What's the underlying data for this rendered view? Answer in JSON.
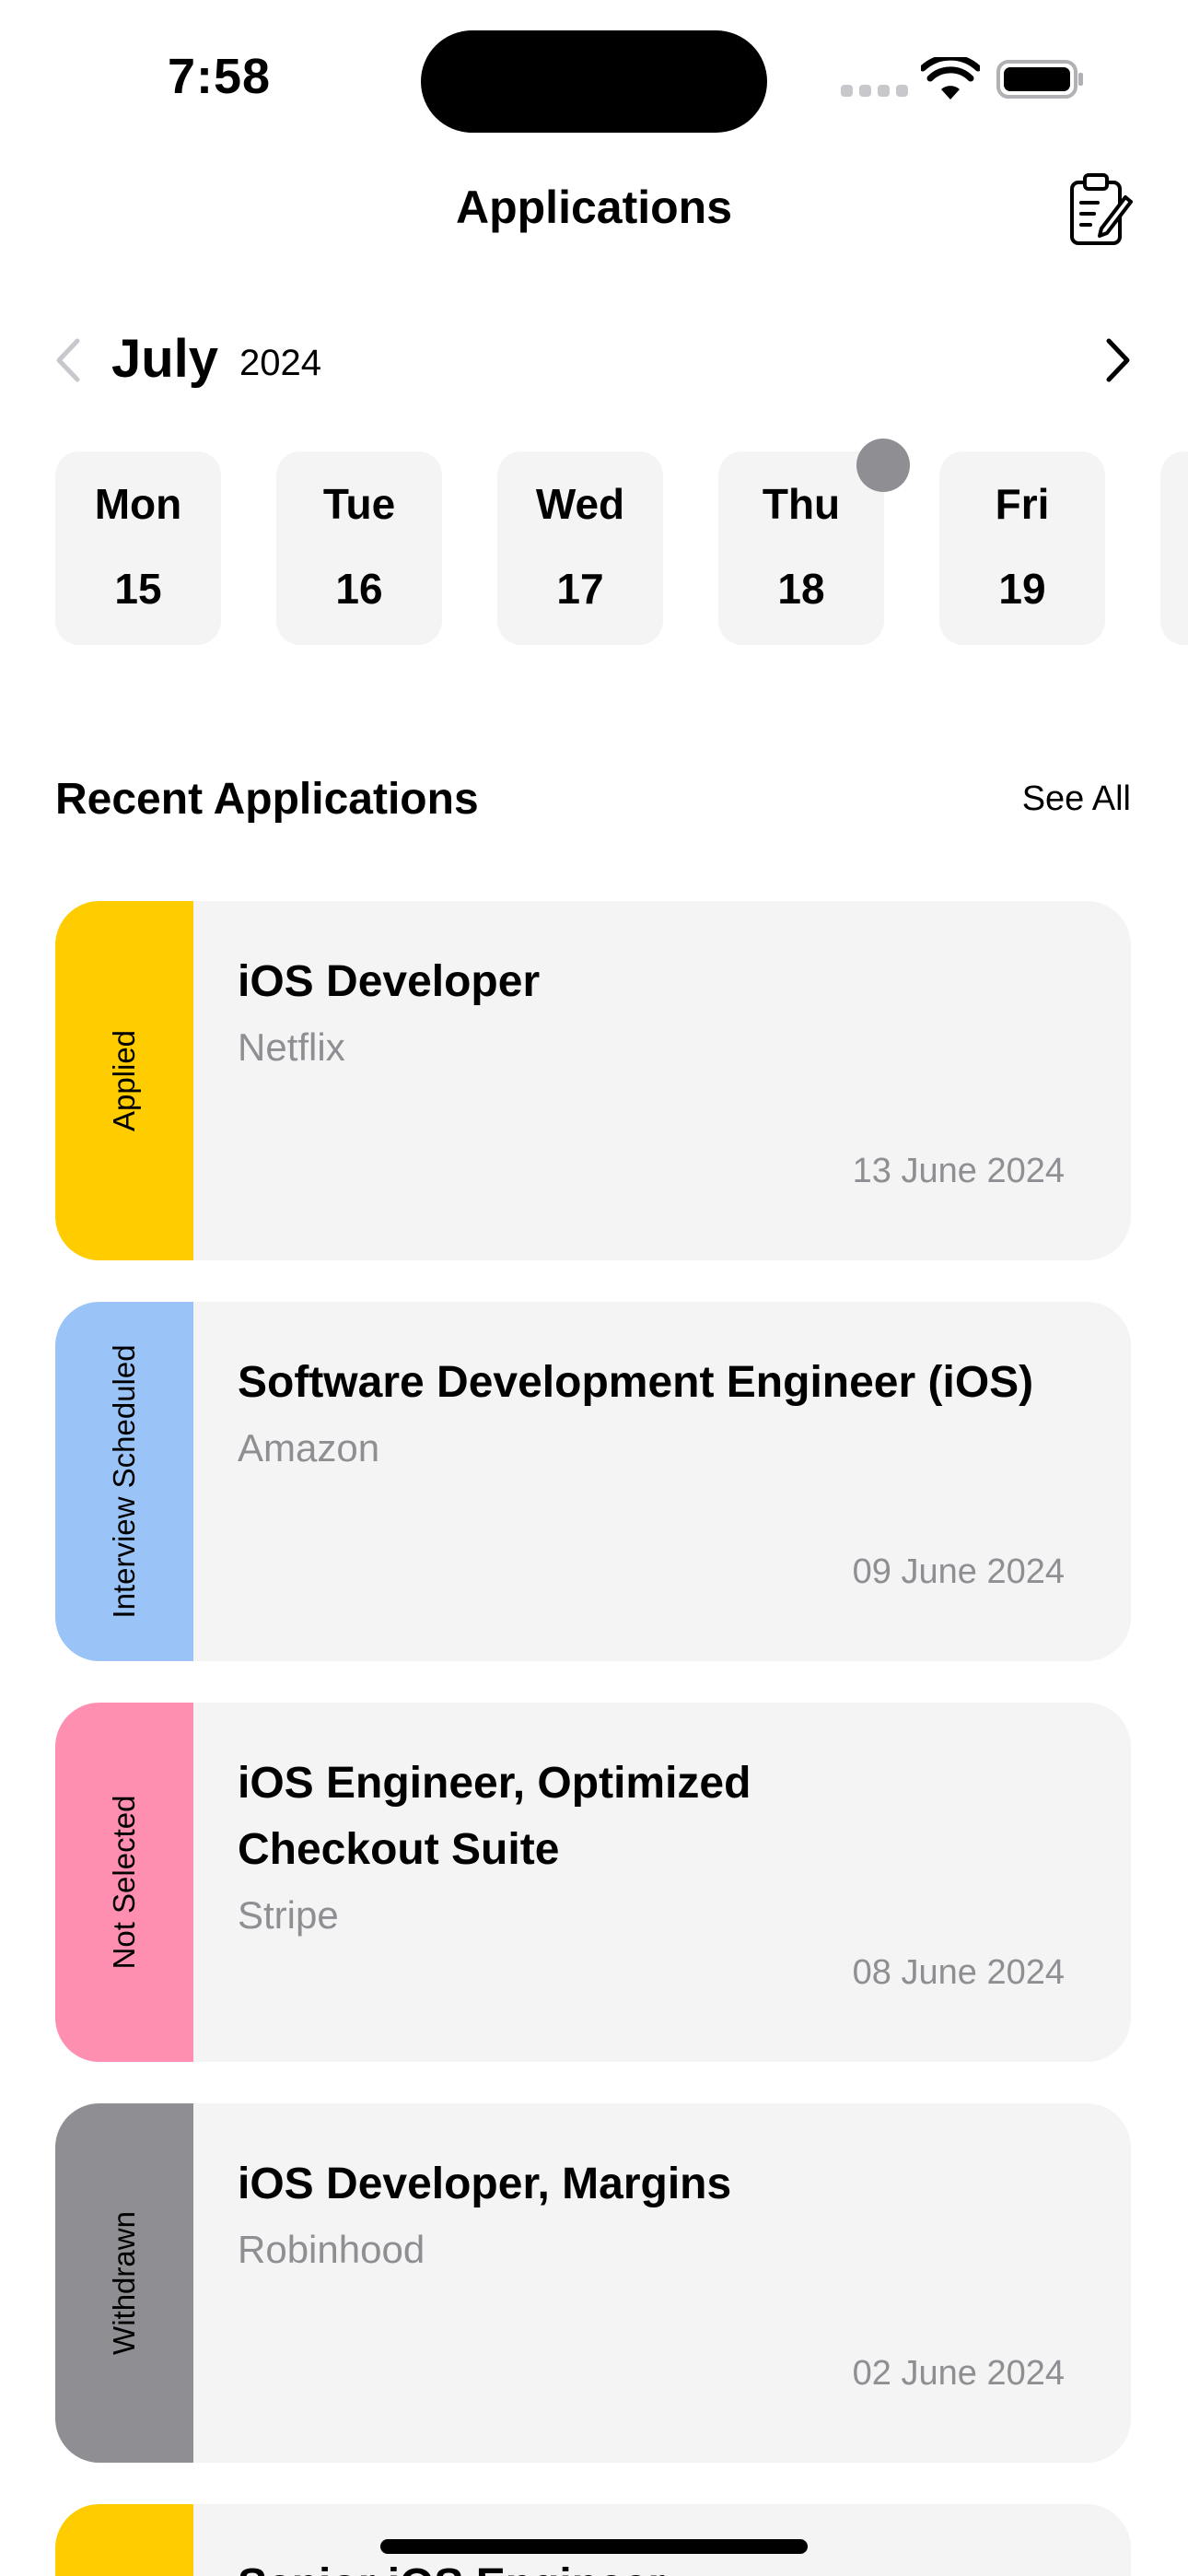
{
  "status_bar": {
    "time": "7:58"
  },
  "nav": {
    "title": "Applications"
  },
  "calendar": {
    "month": "July",
    "year": "2024",
    "days": [
      {
        "name": "Mon",
        "number": "15"
      },
      {
        "name": "Tue",
        "number": "16"
      },
      {
        "name": "Wed",
        "number": "17"
      },
      {
        "name": "Thu",
        "number": "18"
      },
      {
        "name": "Fri",
        "number": "19"
      }
    ]
  },
  "section": {
    "title": "Recent Applications",
    "see_all": "See All"
  },
  "applications": [
    {
      "status": "Applied",
      "status_color": "#FFCC00",
      "title": "iOS Developer",
      "company": "Netflix",
      "date": "13 June 2024"
    },
    {
      "status": "Interview Scheduled",
      "status_color": "#9AC4F8",
      "title": "Software Development Engineer (iOS)",
      "company": "Amazon",
      "date": "09 June 2024"
    },
    {
      "status": "Not Selected",
      "status_color": "#FF8FB1",
      "title": "iOS Engineer, Optimized Checkout Suite",
      "company": "Stripe",
      "date": "08 June 2024"
    },
    {
      "status": "Withdrawn",
      "status_color": "#8E8E93",
      "title": "iOS Developer, Margins",
      "company": "Robinhood",
      "date": "02 June 2024"
    },
    {
      "status_color": "#FFCC00",
      "title": "Senior iOS Engineer"
    }
  ]
}
